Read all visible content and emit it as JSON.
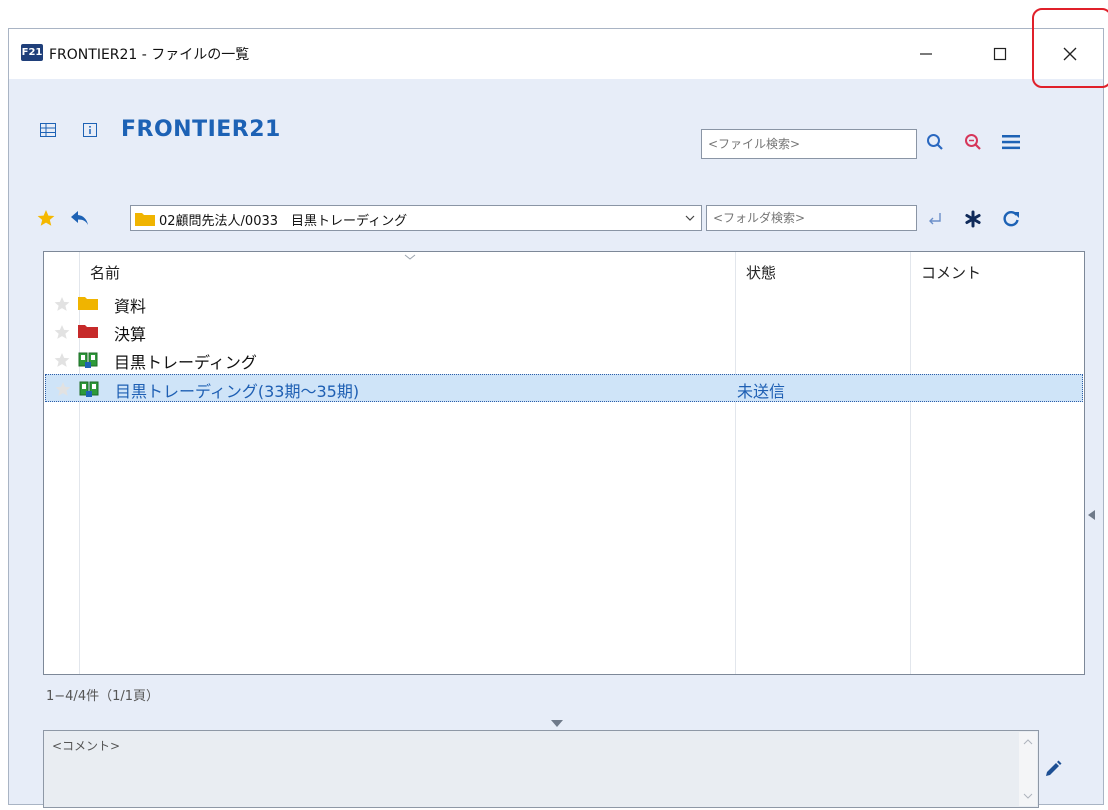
{
  "window": {
    "title": "FRONTIER21 - ファイルの一覧",
    "app_badge": "F21",
    "controls": [
      "minimize",
      "maximize",
      "close"
    ]
  },
  "header": {
    "app_title": "FRONTIER21",
    "file_search_placeholder": "<ファイル検索>",
    "folder_search_placeholder": "<フォルダ検索>",
    "icons": [
      "grid-view-icon",
      "info-icon",
      "search-icon",
      "zoom-out-icon",
      "menu-icon",
      "favorite-star-icon",
      "back-arrow-icon",
      "enter-icon",
      "asterisk-icon",
      "refresh-icon"
    ]
  },
  "path": {
    "current": "02顧問先法人/0033　目黒トレーディング"
  },
  "list": {
    "columns": [
      "名前",
      "状態",
      "コメント"
    ],
    "rows": [
      {
        "name": "資料",
        "status": "",
        "comment": "",
        "icon": "folder-yellow-icon"
      },
      {
        "name": "決算",
        "status": "",
        "comment": "",
        "icon": "folder-red-icon"
      },
      {
        "name": "目黒トレーディング",
        "status": "",
        "comment": "",
        "icon": "book-icon"
      },
      {
        "name": "目黒トレーディング(33期～35期)",
        "status": "未送信",
        "comment": "",
        "icon": "book-icon",
        "selected": true
      }
    ]
  },
  "footer": {
    "count": "1−4/4件（1/1頁）",
    "comment_placeholder": "<コメント>"
  },
  "colors": {
    "accent": "#1d62b5",
    "background": "#e7edf8",
    "selected_row": "#cfe4f8",
    "highlight": "#e0202a",
    "star": "#f5b800"
  }
}
